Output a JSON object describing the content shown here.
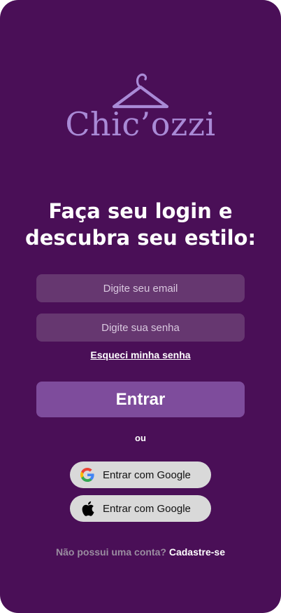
{
  "brand": {
    "name": "Chic’ozzi",
    "color": "#a98ad6"
  },
  "headline": {
    "line1": "Faça seu login e",
    "line2": "descubra seu estilo:"
  },
  "form": {
    "email_placeholder": "Digite seu email",
    "password_placeholder": "Digite sua senha",
    "forgot_label": "Esqueci minha senha",
    "submit_label": "Entrar"
  },
  "divider": {
    "label": "ou"
  },
  "social": {
    "google_label": "Entrar com Google",
    "apple_label": "Entrar com Google",
    "google_icon": "google-icon",
    "apple_icon": "apple-icon"
  },
  "signup": {
    "question": "Não possui uma conta?",
    "link_label": "Cadastre-se"
  },
  "colors": {
    "background": "#4a0f57",
    "field": "#663770",
    "primary_button": "#7e4c9c",
    "social_button": "#d9d9d9"
  }
}
